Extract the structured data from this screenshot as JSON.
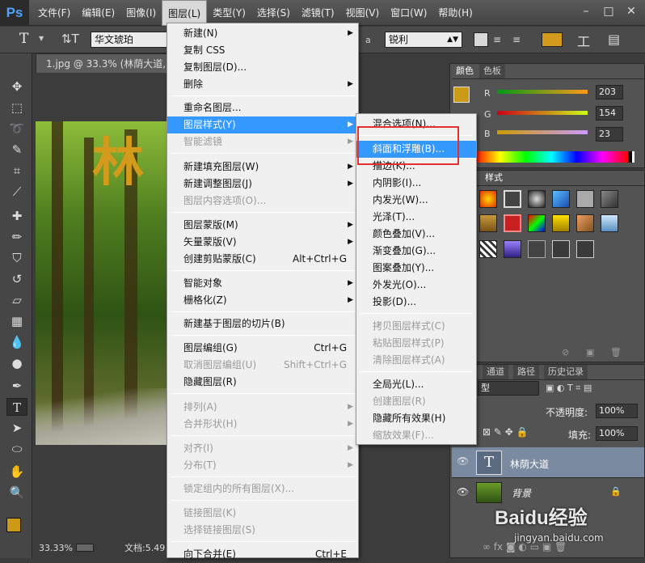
{
  "menubar": {
    "logo": "Ps",
    "items": [
      "文件(F)",
      "编辑(E)",
      "图像(I)",
      "图层(L)",
      "类型(Y)",
      "选择(S)",
      "滤镜(T)",
      "视图(V)",
      "窗口(W)",
      "帮助(H)"
    ],
    "active_index": 3
  },
  "window_controls": [
    "–",
    "□",
    "✕"
  ],
  "options_bar": {
    "font_family": "华文琥珀",
    "aa_label": "a",
    "antialias": "锐利",
    "text_color": "#d49a1b"
  },
  "document": {
    "tab_title": "1.jpg @ 33.3% (林荫大道, R",
    "canvas_text": "林",
    "zoom": "33.33%",
    "doc_info": "文档:5.49"
  },
  "layer_menu": {
    "items": [
      {
        "label": "新建(N)",
        "arrow": true
      },
      {
        "label": "复制 CSS"
      },
      {
        "label": "复制图层(D)..."
      },
      {
        "label": "删除",
        "arrow": true
      },
      {
        "label": "重命名图层..."
      },
      {
        "label": "图层样式(Y)",
        "arrow": true
      },
      {
        "label": "智能滤镜",
        "arrow": true
      },
      {
        "label": "新建填充图层(W)",
        "arrow": true
      },
      {
        "label": "新建调整图层(J)",
        "arrow": true
      },
      {
        "label": "图层内容选项(O)..."
      },
      {
        "label": "图层蒙版(M)",
        "arrow": true
      },
      {
        "label": "矢量蒙版(V)",
        "arrow": true
      },
      {
        "label": "创建剪贴蒙版(C)",
        "shortcut": "Alt+Ctrl+G"
      },
      {
        "label": "智能对象",
        "arrow": true
      },
      {
        "label": "栅格化(Z)",
        "arrow": true
      },
      {
        "label": "新建基于图层的切片(B)"
      },
      {
        "label": "图层编组(G)",
        "shortcut": "Ctrl+G"
      },
      {
        "label": "取消图层编组(U)",
        "shortcut": "Shift+Ctrl+G"
      },
      {
        "label": "隐藏图层(R)"
      },
      {
        "label": "排列(A)",
        "arrow": true
      },
      {
        "label": "合并形状(H)",
        "arrow": true
      },
      {
        "label": "对齐(I)",
        "arrow": true
      },
      {
        "label": "分布(T)",
        "arrow": true
      },
      {
        "label": "锁定组内的所有图层(X)..."
      },
      {
        "label": "链接图层(K)"
      },
      {
        "label": "选择链接图层(S)"
      },
      {
        "label": "向下合并(E)",
        "shortcut": "Ctrl+E"
      }
    ]
  },
  "style_submenu": {
    "items": [
      {
        "label": "混合选项(N)..."
      },
      {
        "label": "斜面和浮雕(B)..."
      },
      {
        "label": "描边(K)..."
      },
      {
        "label": "内阴影(I)..."
      },
      {
        "label": "内发光(W)..."
      },
      {
        "label": "光泽(T)..."
      },
      {
        "label": "颜色叠加(V)..."
      },
      {
        "label": "渐变叠加(G)..."
      },
      {
        "label": "图案叠加(Y)..."
      },
      {
        "label": "外发光(O)..."
      },
      {
        "label": "投影(D)..."
      },
      {
        "label": "拷贝图层样式(C)"
      },
      {
        "label": "粘贴图层样式(P)"
      },
      {
        "label": "清除图层样式(A)"
      },
      {
        "label": "全局光(L)..."
      },
      {
        "label": "创建图层(R)"
      },
      {
        "label": "隐藏所有效果(H)"
      },
      {
        "label": "缩放效果(F)..."
      }
    ],
    "highlight_color": "#e03030"
  },
  "color_panel": {
    "tabs": [
      "颜色",
      "色板"
    ],
    "fg_color": "#cb9a17",
    "r": {
      "label": "R",
      "value": "203"
    },
    "g": {
      "label": "G",
      "value": "154"
    },
    "b": {
      "label": "B",
      "value": "23"
    }
  },
  "styles_panel": {
    "tab": "样式"
  },
  "layers_panel": {
    "tabs": [
      "通道",
      "路径",
      "历史记录"
    ],
    "kind_label": "型",
    "opacity_label": "不透明度:",
    "opacity_value": "100%",
    "fill_label": "填充:",
    "fill_value": "100%",
    "layers": [
      {
        "name": "林荫大道",
        "thumb": "T",
        "selected": true
      },
      {
        "name": "背景",
        "selected": false
      }
    ]
  },
  "watermark": {
    "brand": "Baidu经验",
    "url": "jingyan.baidu.com"
  }
}
